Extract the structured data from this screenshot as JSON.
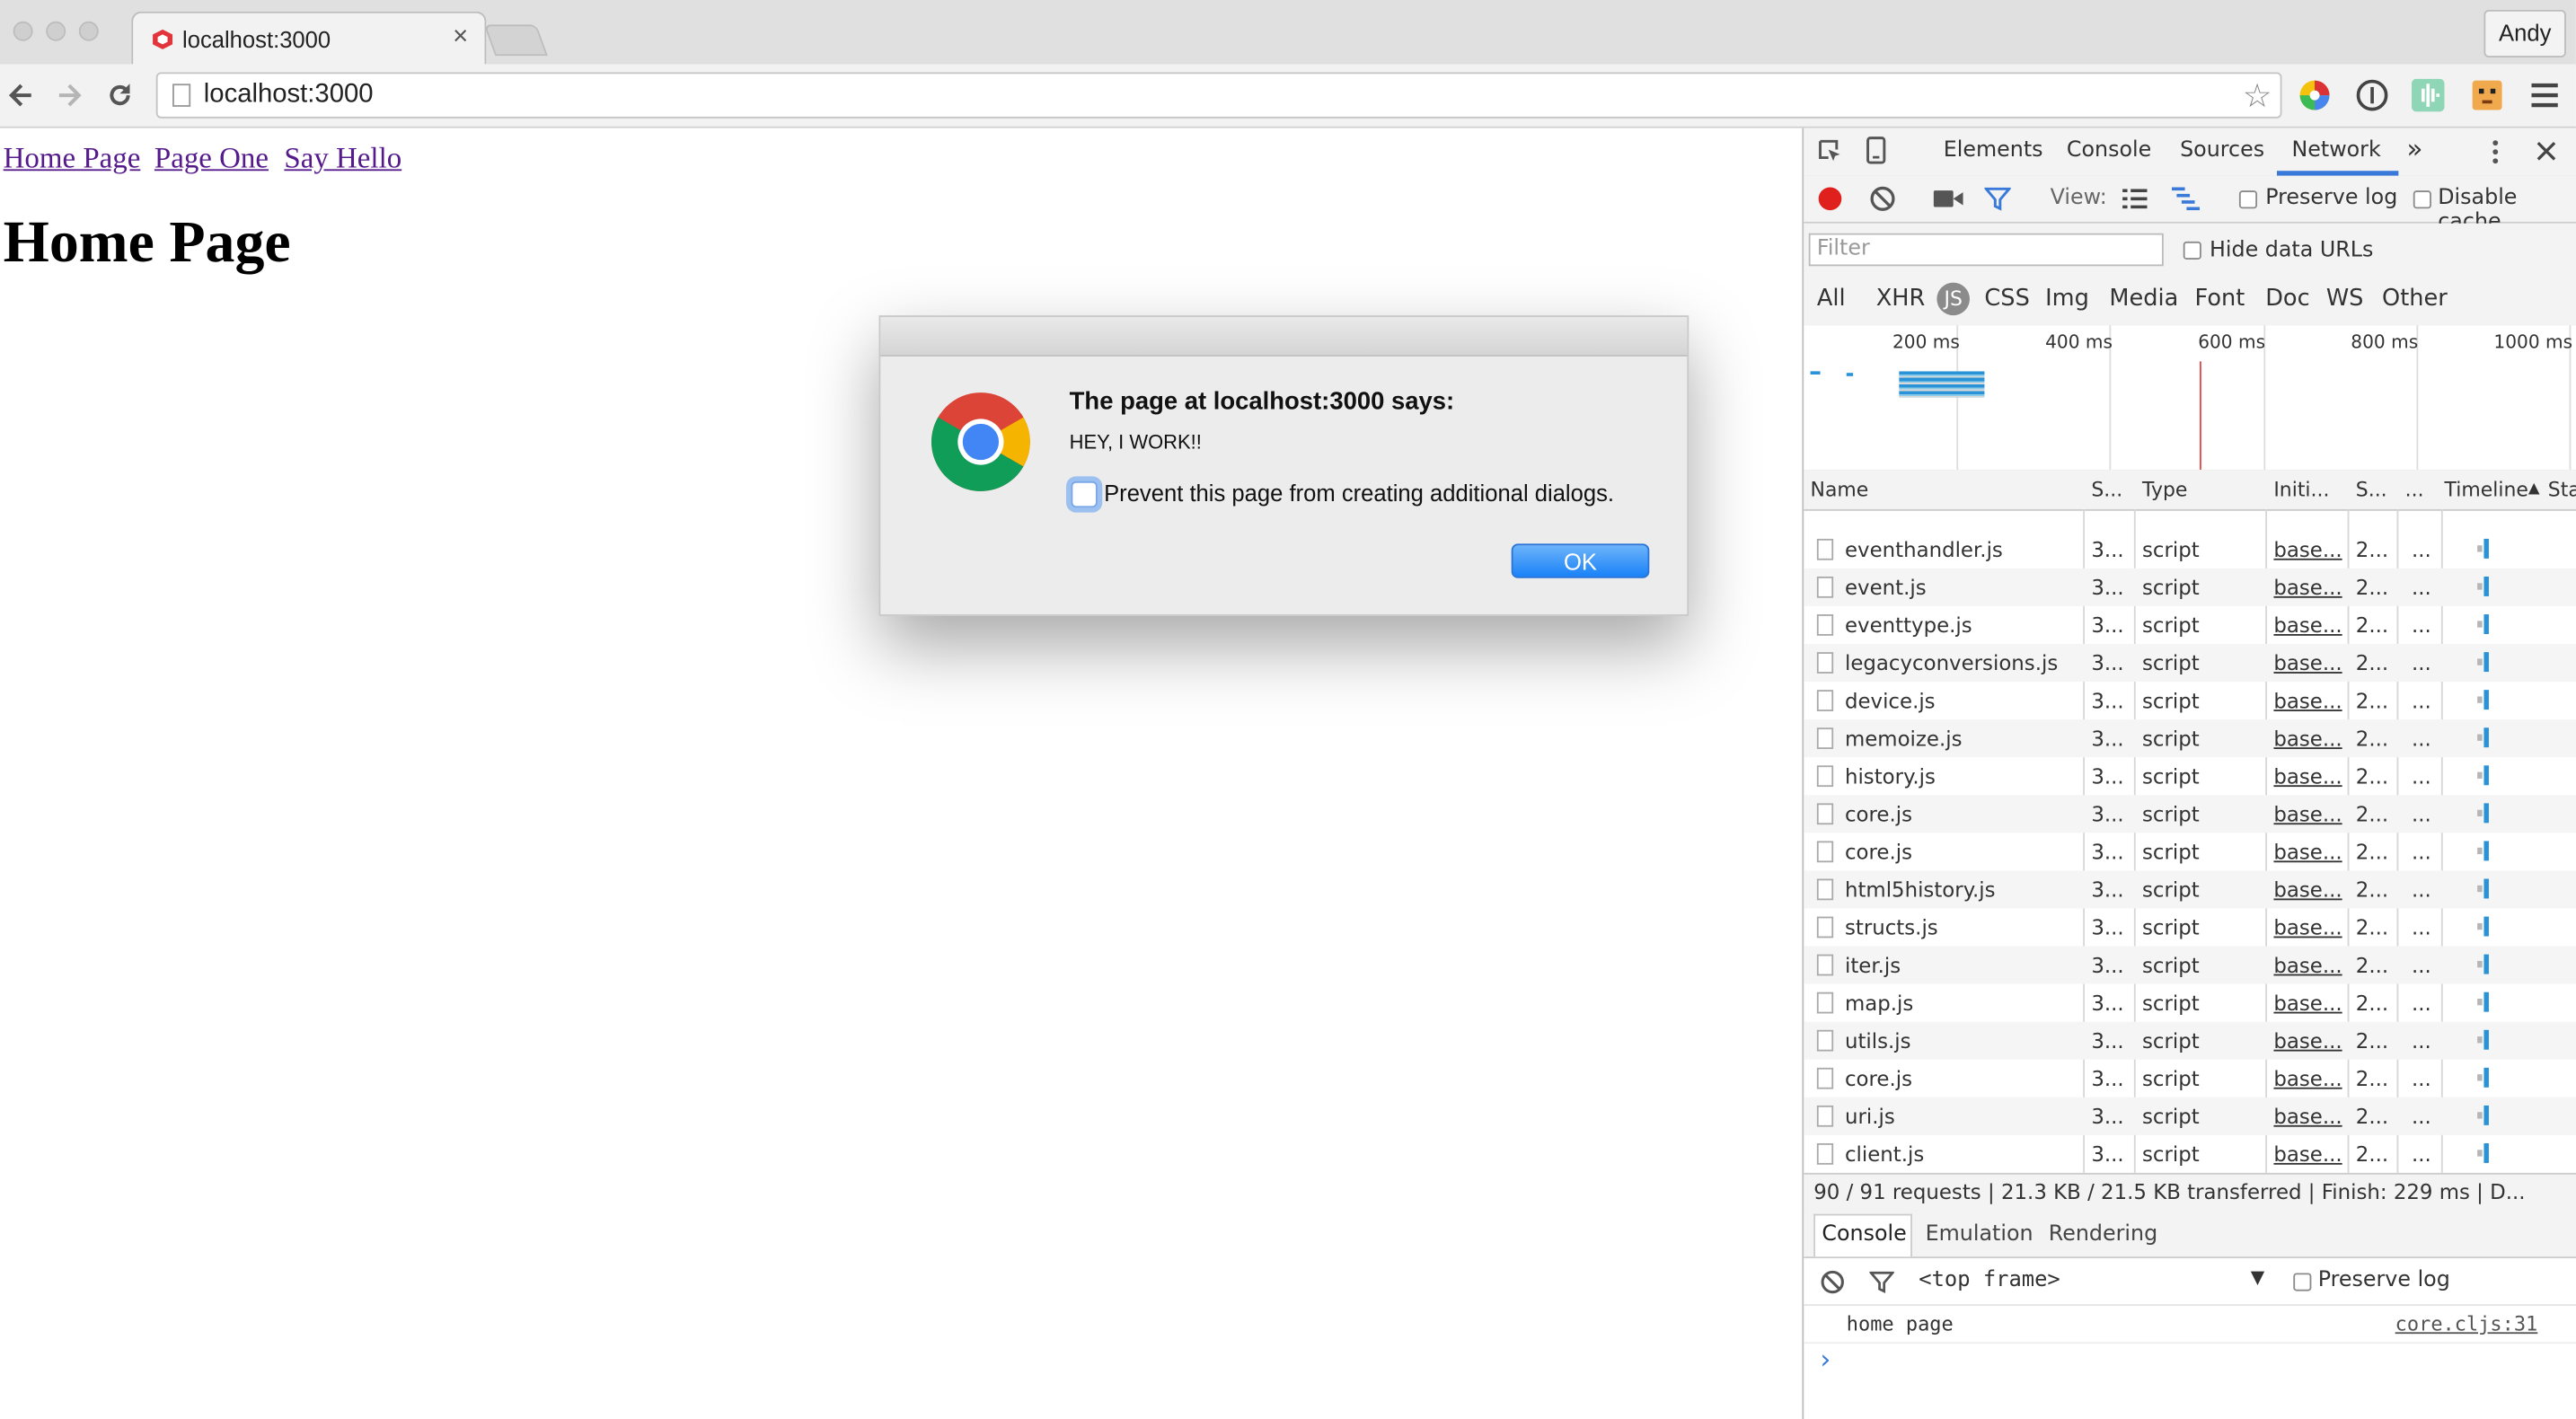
{
  "browser": {
    "tab_title": "localhost:3000",
    "tab_close": "×",
    "profile_name": "Andy",
    "url": "localhost:3000",
    "star": "☆"
  },
  "page": {
    "nav_links": [
      "Home Page",
      "Page One",
      "Say Hello"
    ],
    "title": "Home Page"
  },
  "dialog": {
    "title": "The page at localhost:3000 says:",
    "message": "HEY, I WORK!!",
    "checkbox_label": "Prevent this page from creating additional dialogs.",
    "ok_label": "OK"
  },
  "devtools": {
    "tabs": [
      "Elements",
      "Console",
      "Sources",
      "Network"
    ],
    "active_tab": "Network",
    "more": "»",
    "view_label": "View:",
    "preserve_log": "Preserve log",
    "disable_cache": "Disable cache",
    "filter_placeholder": "Filter",
    "hide_data_urls": "Hide data URLs",
    "types": [
      "All",
      "XHR",
      "JS",
      "CSS",
      "Img",
      "Media",
      "Font",
      "Doc",
      "WS",
      "Other"
    ],
    "timeline_ticks": [
      "200 ms",
      "400 ms",
      "600 ms",
      "800 ms",
      "1000 ms"
    ],
    "columns": [
      "Name",
      "S...",
      "Type",
      "Initi...",
      "S...",
      "...",
      "Timeline",
      "Sta"
    ],
    "rows": [
      {
        "name": "eventhandler.js",
        "status": "3...",
        "type": "script",
        "initiator": "base...",
        "size": "2...",
        "time": "..."
      },
      {
        "name": "event.js",
        "status": "3...",
        "type": "script",
        "initiator": "base...",
        "size": "2...",
        "time": "..."
      },
      {
        "name": "eventtype.js",
        "status": "3...",
        "type": "script",
        "initiator": "base...",
        "size": "2...",
        "time": "..."
      },
      {
        "name": "legacyconversions.js",
        "status": "3...",
        "type": "script",
        "initiator": "base...",
        "size": "2...",
        "time": "..."
      },
      {
        "name": "device.js",
        "status": "3...",
        "type": "script",
        "initiator": "base...",
        "size": "2...",
        "time": "..."
      },
      {
        "name": "memoize.js",
        "status": "3...",
        "type": "script",
        "initiator": "base...",
        "size": "2...",
        "time": "..."
      },
      {
        "name": "history.js",
        "status": "3...",
        "type": "script",
        "initiator": "base...",
        "size": "2...",
        "time": "..."
      },
      {
        "name": "core.js",
        "status": "3...",
        "type": "script",
        "initiator": "base...",
        "size": "2...",
        "time": "..."
      },
      {
        "name": "core.js",
        "status": "3...",
        "type": "script",
        "initiator": "base...",
        "size": "2...",
        "time": "..."
      },
      {
        "name": "html5history.js",
        "status": "3...",
        "type": "script",
        "initiator": "base...",
        "size": "2...",
        "time": "..."
      },
      {
        "name": "structs.js",
        "status": "3...",
        "type": "script",
        "initiator": "base...",
        "size": "2...",
        "time": "..."
      },
      {
        "name": "iter.js",
        "status": "3...",
        "type": "script",
        "initiator": "base...",
        "size": "2...",
        "time": "..."
      },
      {
        "name": "map.js",
        "status": "3...",
        "type": "script",
        "initiator": "base...",
        "size": "2...",
        "time": "..."
      },
      {
        "name": "utils.js",
        "status": "3...",
        "type": "script",
        "initiator": "base...",
        "size": "2...",
        "time": "..."
      },
      {
        "name": "core.js",
        "status": "3...",
        "type": "script",
        "initiator": "base...",
        "size": "2...",
        "time": "..."
      },
      {
        "name": "uri.js",
        "status": "3...",
        "type": "script",
        "initiator": "base...",
        "size": "2...",
        "time": "..."
      },
      {
        "name": "client.js",
        "status": "3...",
        "type": "script",
        "initiator": "base...",
        "size": "2...",
        "time": "..."
      }
    ],
    "status_summary": "90 / 91 requests | 21.3 KB / 21.5 KB transferred | Finish: 229 ms | D...",
    "drawer_tabs": [
      "Console",
      "Emulation",
      "Rendering"
    ],
    "frame_select": "<top frame>",
    "console_preserve_log": "Preserve log",
    "console_message": "home page",
    "console_source": "core.cljs:31",
    "prompt": "›"
  },
  "colors": {
    "link_visited": "#551a8b",
    "devtools_accent": "#3879d9",
    "record_red": "#e0201d",
    "ok_button": "#1a82f7"
  }
}
